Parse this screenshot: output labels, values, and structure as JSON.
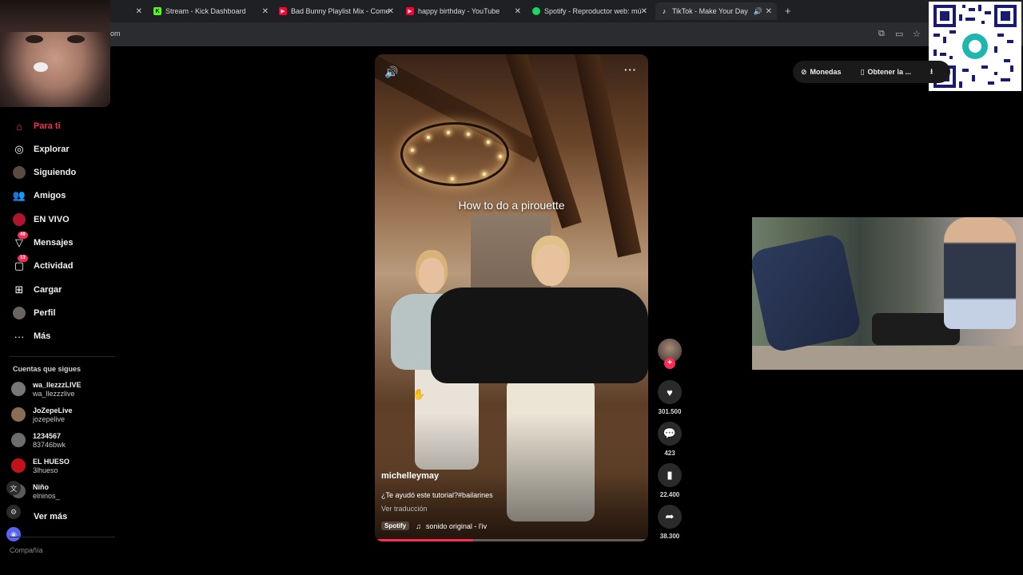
{
  "browser": {
    "tabs": [
      {
        "title": "Stream - Kick Dashboard",
        "icon": "kick-icon",
        "color": "#53fc18"
      },
      {
        "title": "Bad Bunny Playlist Mix - Come",
        "icon": "youtube-icon",
        "color": "#ff0033"
      },
      {
        "title": "happy birthday - YouTube",
        "icon": "youtube-icon",
        "color": "#ff0033"
      },
      {
        "title": "Spotify - Reproductor web: mú",
        "icon": "spotify-icon",
        "color": "#1ed760"
      },
      {
        "title": "TikTok - Make Your Day",
        "icon": "tiktok-icon",
        "color": "#ffffff"
      }
    ],
    "address_fragment": "om"
  },
  "sidebar": {
    "nav": [
      {
        "label": "Para ti",
        "icon": "home-icon",
        "active": true
      },
      {
        "label": "Explorar",
        "icon": "compass-icon"
      },
      {
        "label": "Siguiendo",
        "icon": "following-icon"
      },
      {
        "label": "Amigos",
        "icon": "friends-icon"
      },
      {
        "label": "EN VIVO",
        "icon": "live-icon"
      },
      {
        "label": "Mensajes",
        "icon": "messages-icon",
        "badge": "49"
      },
      {
        "label": "Actividad",
        "icon": "activity-icon",
        "badge": "13"
      },
      {
        "label": "Cargar",
        "icon": "upload-icon"
      },
      {
        "label": "Perfil",
        "icon": "profile-icon"
      },
      {
        "label": "Más",
        "icon": "more-icon"
      }
    ],
    "following_title": "Cuentas que sigues",
    "following": [
      {
        "name": "wa_llezzzLIVE",
        "handle": "wa_llezzzlive",
        "color": "#777777"
      },
      {
        "name": "JoZepeLive",
        "handle": "jozepelive",
        "color": "#8a6d55"
      },
      {
        "name": "1234567",
        "handle": "83746bwk",
        "color": "#6d6d6d"
      },
      {
        "name": "EL HUESO",
        "handle": "3lhueso",
        "color": "#c4121b"
      },
      {
        "name": "Niño",
        "handle": "elninos_",
        "color": "#5a5a5a"
      }
    ],
    "see_more": "Ver más",
    "cut_text": "Compañía"
  },
  "video": {
    "caption_overlay": "How to do a pirouette",
    "author": "michelleymay",
    "description": "¿Te ayudó este tutorial?#bailarines",
    "translate": "Ver traducción",
    "spotify_tag": "Spotify",
    "music": "sonido original - l'iv",
    "progress": 0.36
  },
  "actions": {
    "likes": "301.500",
    "comments": "423",
    "saves": "22.400",
    "shares": "38.300"
  },
  "topbar": {
    "coins": "Monedas",
    "get_app": "Obtener la ..."
  },
  "colors": {
    "accent": "#fe2c55",
    "background": "#000000"
  }
}
